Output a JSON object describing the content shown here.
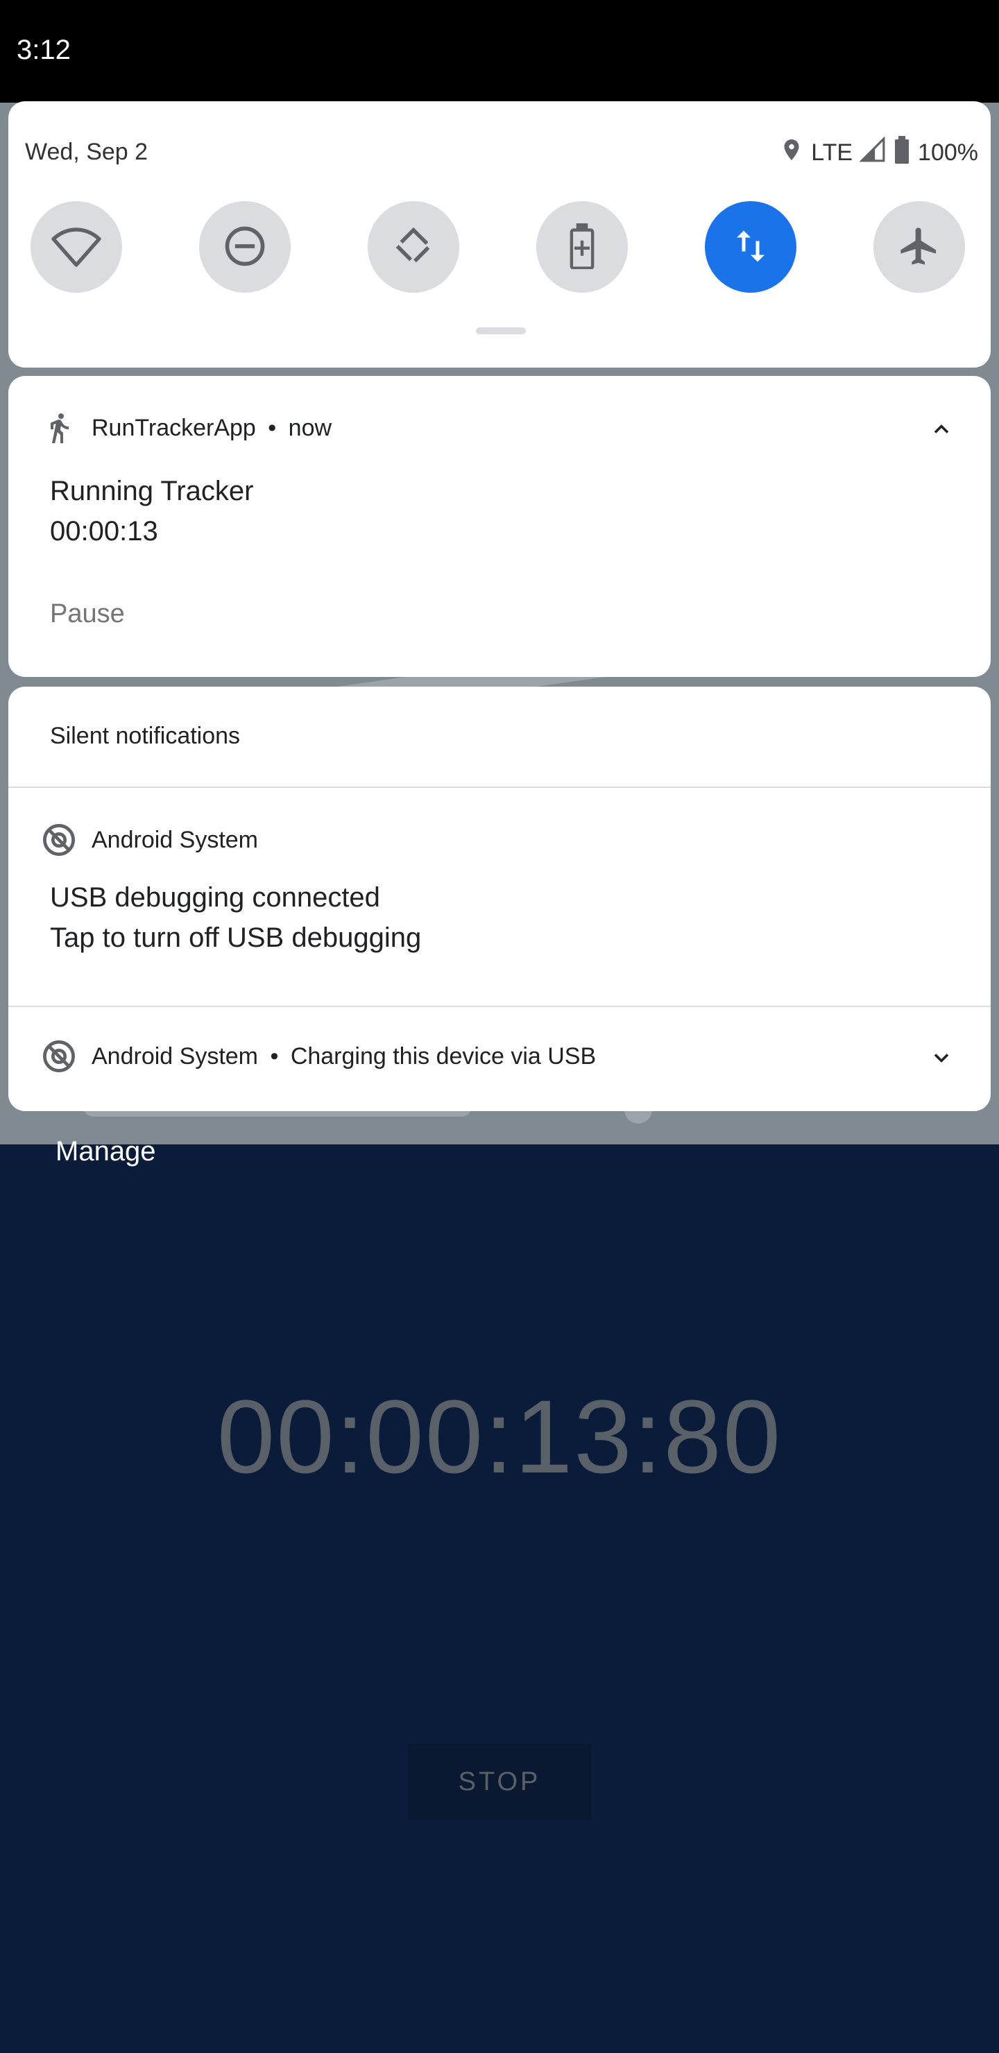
{
  "status_bar": {
    "time": "3:12"
  },
  "quick_settings": {
    "date": "Wed, Sep 2",
    "network": "LTE",
    "battery": "100%",
    "tiles": [
      {
        "name": "wifi",
        "icon": "wifi-icon",
        "active": false
      },
      {
        "name": "do-not-disturb",
        "icon": "do-not-disturb-icon",
        "active": false
      },
      {
        "name": "auto-rotate",
        "icon": "auto-rotate-icon",
        "active": false
      },
      {
        "name": "battery-saver",
        "icon": "battery-saver-icon",
        "active": false
      },
      {
        "name": "mobile-data",
        "icon": "mobile-data-icon",
        "active": true
      },
      {
        "name": "airplane-mode",
        "icon": "airplane-icon",
        "active": false
      }
    ],
    "colors": {
      "active": "#1a73e8",
      "inactive": "#dadce0"
    }
  },
  "notifications": {
    "tracker": {
      "app_name": "RunTrackerApp",
      "time": "now",
      "title": "Running Tracker",
      "text": "00:00:13",
      "action": "Pause",
      "icon": "runner-icon"
    },
    "silent_header": "Silent notifications",
    "usb_debugging": {
      "app_name": "Android System",
      "title": "USB debugging connected",
      "text": "Tap to turn off USB debugging",
      "icon": "android-system-icon"
    },
    "usb_charging": {
      "app_name": "Android System",
      "summary": "Charging this device via USB",
      "icon": "android-system-icon"
    },
    "separator": "•"
  },
  "background_app": {
    "manage_label": "Manage",
    "timer": "00:00:13:80",
    "stop_label": "STOP"
  }
}
